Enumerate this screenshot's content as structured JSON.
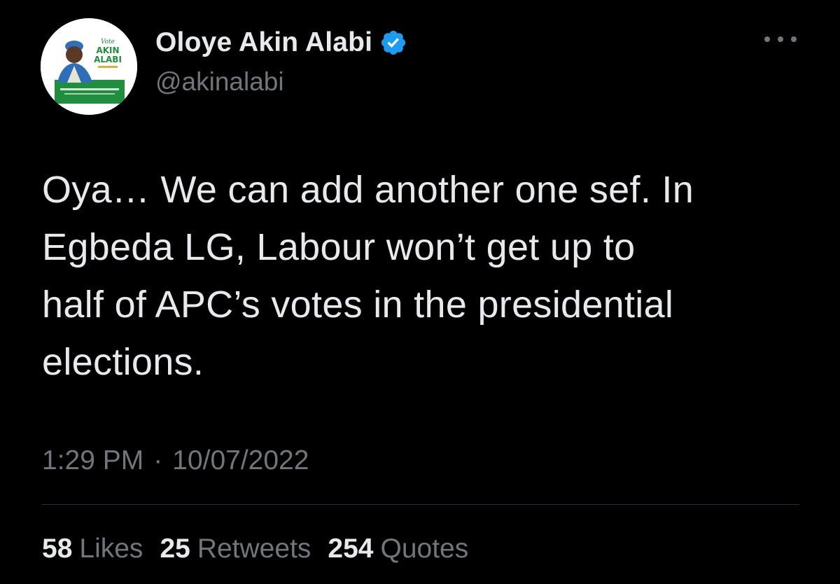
{
  "author": {
    "name": "Oloye Akin Alabi",
    "handle": "@akinalabi",
    "verified": true,
    "avatar_text": {
      "vote": "Vote",
      "first": "AKIN",
      "last": "ALABI"
    }
  },
  "tweet": {
    "text": "Oya… We can add another one sef. In\nEgbeda LG, Labour won’t get up to\nhalf of APC’s votes in the presidential\nelections.",
    "time": "1:29 PM",
    "separator": "·",
    "date": "10/07/2022"
  },
  "stats": {
    "likes_count": "58",
    "likes_label": "Likes",
    "retweets_count": "25",
    "retweets_label": "Retweets",
    "quotes_count": "254",
    "quotes_label": "Quotes"
  },
  "icons": {
    "verified": "verified-badge-icon",
    "more": "more-options-icon"
  },
  "colors": {
    "background": "#000000",
    "text": "#e7e9ea",
    "muted": "#71767b",
    "verified": "#1d9bf0",
    "divider": "#2f3336"
  }
}
